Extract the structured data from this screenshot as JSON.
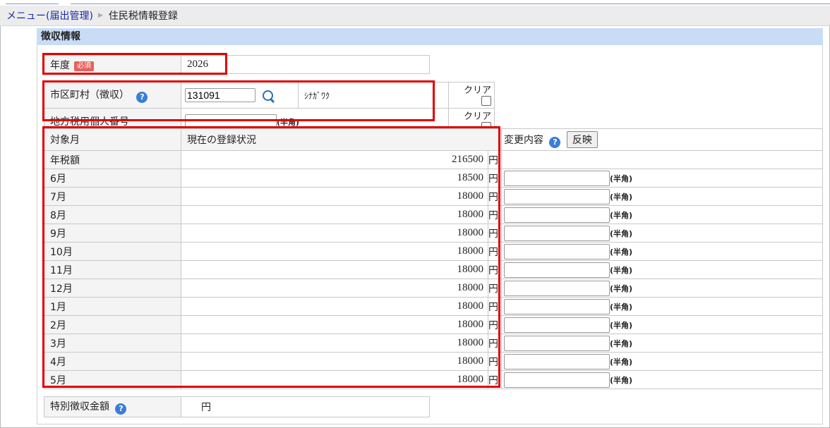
{
  "breadcrumb": {
    "menu_link": "メニュー(届出管理)",
    "current": "住民税情報登録"
  },
  "section_title": "徴収情報",
  "year": {
    "label": "年度",
    "required_badge": "必須",
    "value": "2026"
  },
  "municipality": {
    "label": "市区町村（徴収）",
    "code": "131091",
    "name": "ｼﾅｶﾞﾜｸ",
    "clear_label": "クリア"
  },
  "personal_number": {
    "label": "地方税用個人番号",
    "value": "",
    "hint": "(半角)",
    "clear_label": "クリア"
  },
  "monthly": {
    "header_month": "対象月",
    "header_status": "現在の登録状況",
    "header_change": "変更内容",
    "apply_button": "反映",
    "yen": "円",
    "hint": "(半角)",
    "annual_label": "年税額",
    "annual_amount": "216500",
    "rows": [
      {
        "month": "6月",
        "amount": "18500"
      },
      {
        "month": "7月",
        "amount": "18000"
      },
      {
        "month": "8月",
        "amount": "18000"
      },
      {
        "month": "9月",
        "amount": "18000"
      },
      {
        "month": "10月",
        "amount": "18000"
      },
      {
        "month": "11月",
        "amount": "18000"
      },
      {
        "month": "12月",
        "amount": "18000"
      },
      {
        "month": "1月",
        "amount": "18000"
      },
      {
        "month": "2月",
        "amount": "18000"
      },
      {
        "month": "3月",
        "amount": "18000"
      },
      {
        "month": "4月",
        "amount": "18000"
      },
      {
        "month": "5月",
        "amount": "18000"
      }
    ]
  },
  "special_collection": {
    "label": "特別徴収金額",
    "value": "",
    "yen": "円"
  },
  "icons": {
    "help": "help-icon",
    "search": "search-icon"
  },
  "colors": {
    "highlight_border": "#e00000",
    "section_bg": "#c9dcf6",
    "required_badge": "#e8605c",
    "help_icon": "#3a7ed6",
    "link": "#1a2aa8"
  }
}
